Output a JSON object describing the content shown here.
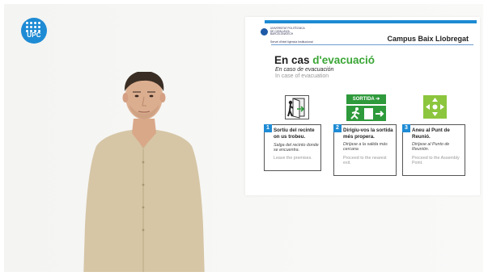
{
  "logo": {
    "text": "UPC"
  },
  "slide": {
    "header": {
      "university_lines": [
        "UNIVERSITAT POLITÈCNICA",
        "DE CATALUNYA",
        "BARCELONATECH"
      ],
      "unit": "Servei d'Intel·ligència Institucional",
      "campus": "Campus Baix Llobregat"
    },
    "title_black": "En cas ",
    "title_green": "d'evacuació",
    "subtitle_es": "En caso de evacuación",
    "subtitle_en": "In case of evacuation",
    "exit_sign_text": "SORTIDA ➔",
    "steps": [
      {
        "num": "1",
        "ca": "Sortiu del recinte on us trobeu.",
        "es": "Salga del recinto donde se encuentra.",
        "en": "Leave the premises."
      },
      {
        "num": "2",
        "ca": "Dirigiu-vos la sortida més propera.",
        "es": "Diríjase a la salida más cercana",
        "en": "Proceed to the nearest exit."
      },
      {
        "num": "3",
        "ca": "Aneu al Punt de Reunió.",
        "es": "Diríjase al Punto de Reunión.",
        "en": "Proceed to the Assembly Point."
      }
    ]
  },
  "colors": {
    "brand_blue": "#1e8bd4",
    "evacuation_green": "#3aa635",
    "exit_green": "#2e9a3b",
    "assembly_green": "#8cc63e"
  }
}
